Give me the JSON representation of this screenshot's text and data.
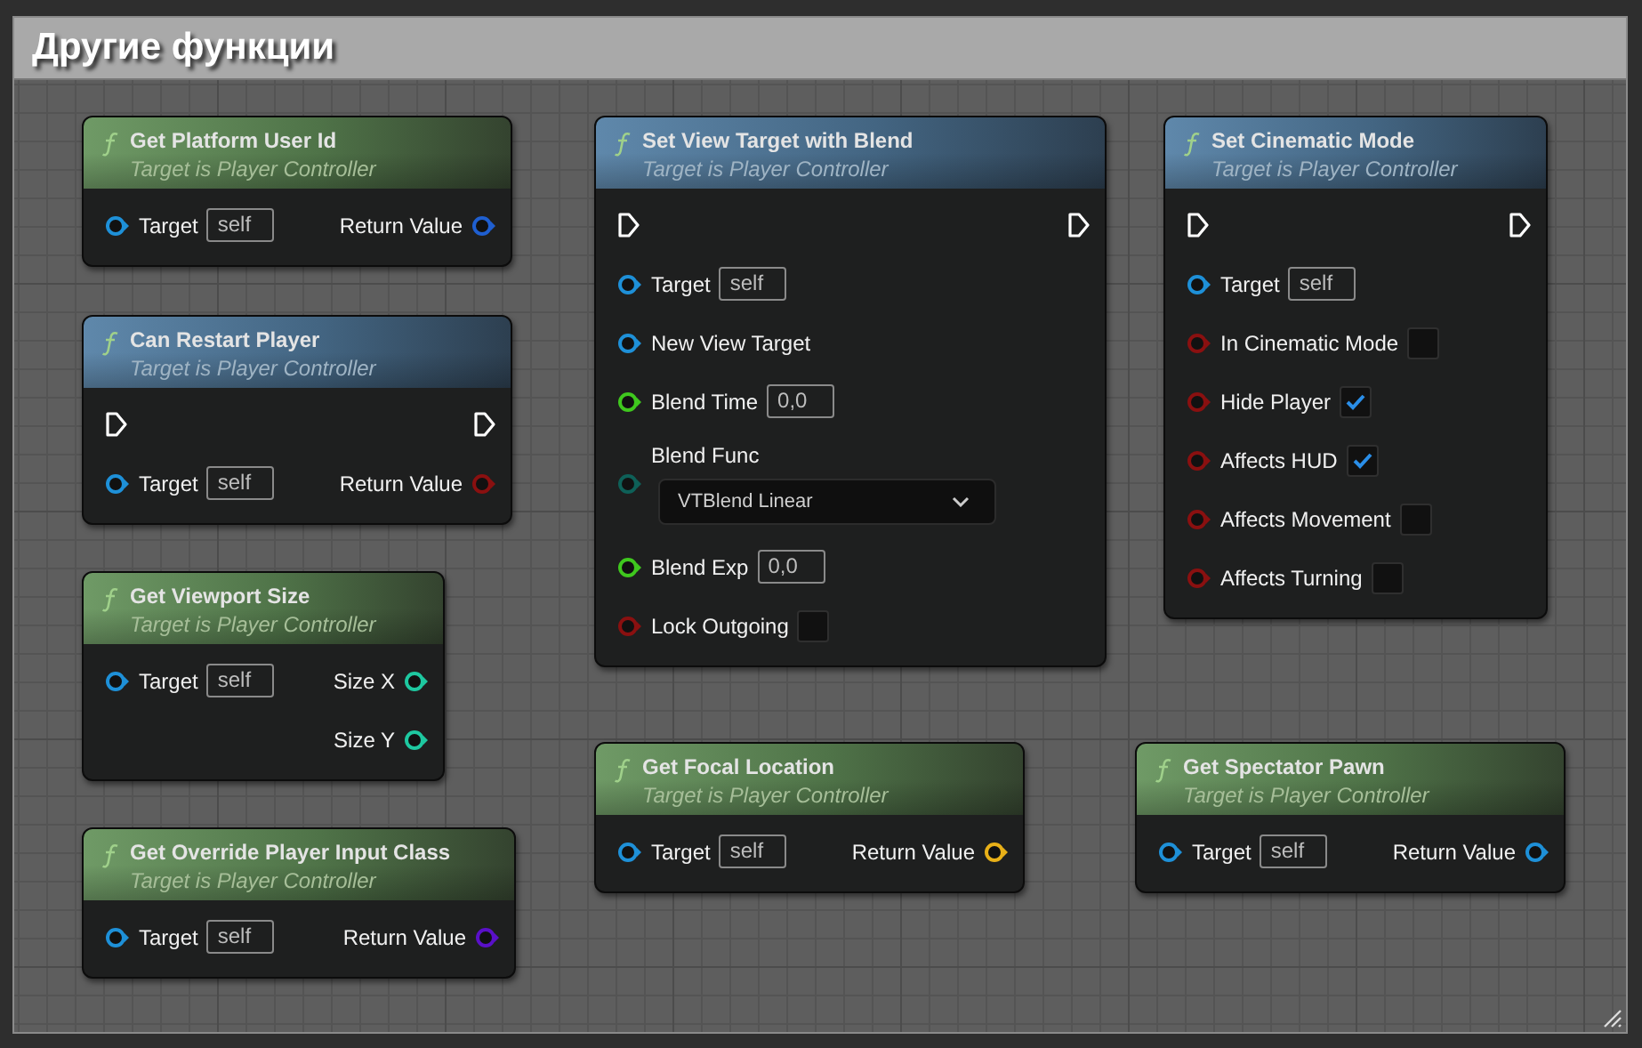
{
  "comment": {
    "title": "Другие функции"
  },
  "nodes": [
    {
      "kind": "pure",
      "title": "Get Platform User Id",
      "subtitle": "Target is Player Controller",
      "rows": [
        {
          "in": {
            "kind": "pin",
            "label": "Target",
            "value": "self",
            "color": "#1e90d8"
          },
          "out": {
            "kind": "pin",
            "label": "Return Value",
            "color": "#1f5fd0"
          }
        }
      ]
    },
    {
      "kind": "impure",
      "title": "Can Restart Player",
      "subtitle": "Target is Player Controller",
      "rows": [
        {
          "in": {
            "kind": "exec"
          },
          "out": {
            "kind": "exec"
          }
        },
        {
          "in": {
            "kind": "pin",
            "label": "Target",
            "value": "self",
            "color": "#1e90d8"
          },
          "out": {
            "kind": "pin",
            "label": "Return Value",
            "color": "#8a1010"
          }
        }
      ]
    },
    {
      "kind": "pure",
      "title": "Get Viewport Size",
      "subtitle": "Target is Player Controller",
      "rows": [
        {
          "in": {
            "kind": "pin",
            "label": "Target",
            "value": "self",
            "color": "#1e90d8"
          },
          "out": {
            "kind": "pin",
            "label": "Size X",
            "color": "#1ec8a0"
          }
        },
        {
          "out": {
            "kind": "pin",
            "label": "Size Y",
            "color": "#1ec8a0"
          }
        }
      ]
    },
    {
      "kind": "pure",
      "title": "Get Override Player Input Class",
      "subtitle": "Target is Player Controller",
      "rows": [
        {
          "in": {
            "kind": "pin",
            "label": "Target",
            "value": "self",
            "color": "#1e90d8"
          },
          "out": {
            "kind": "pin",
            "label": "Return Value",
            "color": "#5a10c8"
          }
        }
      ]
    },
    {
      "kind": "impure",
      "title": "Set View Target with Blend",
      "subtitle": "Target is Player Controller",
      "rows": [
        {
          "in": {
            "kind": "exec"
          },
          "out": {
            "kind": "exec"
          }
        },
        {
          "in": {
            "kind": "pin",
            "label": "Target",
            "value": "self",
            "color": "#1e90d8"
          }
        },
        {
          "in": {
            "kind": "pin",
            "label": "New View Target",
            "color": "#1e90d8"
          }
        },
        {
          "in": {
            "kind": "pin",
            "label": "Blend Time",
            "value": "0,0",
            "color": "#3fc81e"
          }
        },
        {
          "in": {
            "kind": "dropdown",
            "label": "Blend Func",
            "value": "VTBlend Linear",
            "color": "#0e6058"
          }
        },
        {
          "in": {
            "kind": "pin",
            "label": "Blend Exp",
            "value": "0,0",
            "color": "#3fc81e"
          }
        },
        {
          "in": {
            "kind": "checkbox",
            "label": "Lock Outgoing",
            "checked": false,
            "color": "#8a1010"
          }
        }
      ]
    },
    {
      "kind": "impure",
      "title": "Set Cinematic Mode",
      "subtitle": "Target is Player Controller",
      "rows": [
        {
          "in": {
            "kind": "exec"
          },
          "out": {
            "kind": "exec"
          }
        },
        {
          "in": {
            "kind": "pin",
            "label": "Target",
            "value": "self",
            "color": "#1e90d8"
          }
        },
        {
          "in": {
            "kind": "checkbox",
            "label": "In Cinematic Mode",
            "checked": false,
            "color": "#8a1010"
          }
        },
        {
          "in": {
            "kind": "checkbox",
            "label": "Hide Player",
            "checked": true,
            "color": "#8a1010"
          }
        },
        {
          "in": {
            "kind": "checkbox",
            "label": "Affects HUD",
            "checked": true,
            "color": "#8a1010"
          }
        },
        {
          "in": {
            "kind": "checkbox",
            "label": "Affects Movement",
            "checked": false,
            "color": "#8a1010"
          }
        },
        {
          "in": {
            "kind": "checkbox",
            "label": "Affects Turning",
            "checked": false,
            "color": "#8a1010"
          }
        }
      ]
    },
    {
      "kind": "pure",
      "title": "Get Focal Location",
      "subtitle": "Target is Player Controller",
      "rows": [
        {
          "in": {
            "kind": "pin",
            "label": "Target",
            "value": "self",
            "color": "#1e90d8"
          },
          "out": {
            "kind": "pin",
            "label": "Return Value",
            "color": "#e8b018"
          }
        }
      ]
    },
    {
      "kind": "pure",
      "title": "Get Spectator Pawn",
      "subtitle": "Target is Player Controller",
      "rows": [
        {
          "in": {
            "kind": "pin",
            "label": "Target",
            "value": "self",
            "color": "#1e90d8"
          },
          "out": {
            "kind": "pin",
            "label": "Return Value",
            "color": "#1e90d8"
          }
        }
      ]
    }
  ]
}
